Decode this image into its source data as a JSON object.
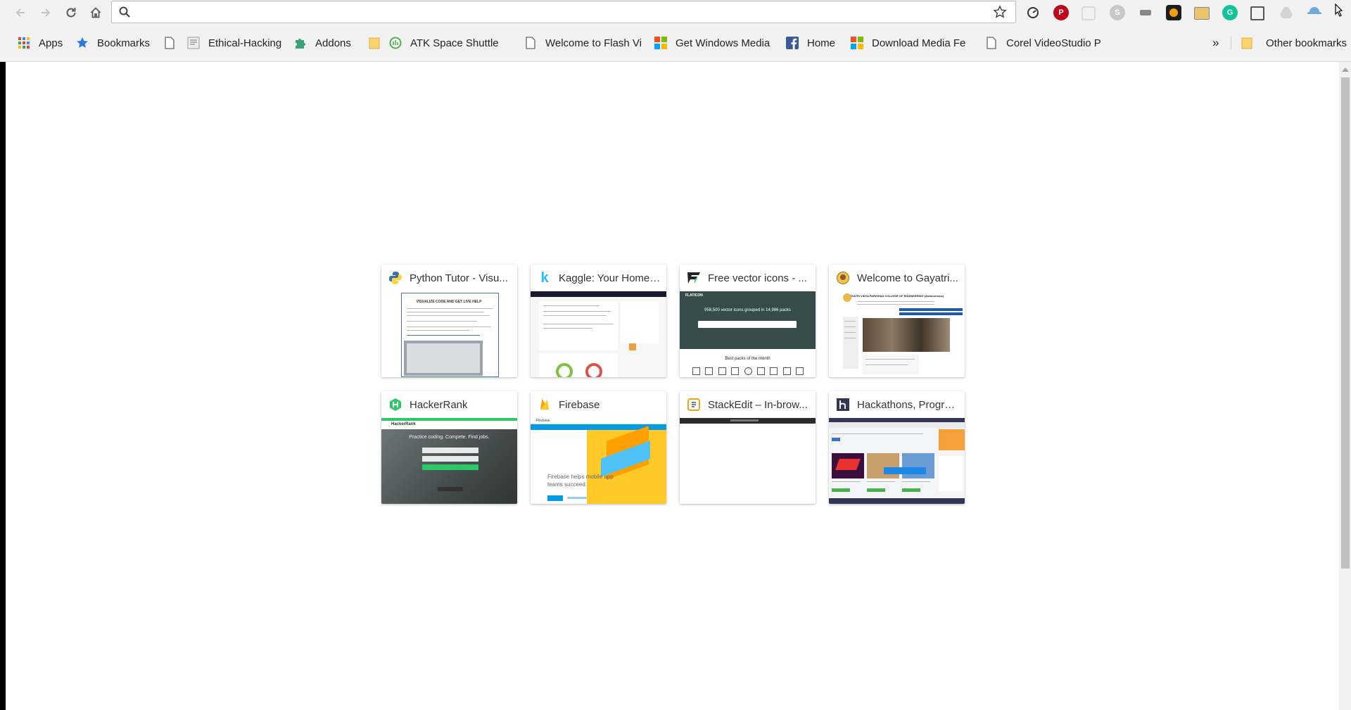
{
  "toolbar": {
    "back_icon": "back-arrow-icon",
    "forward_icon": "forward-arrow-icon",
    "reload_icon": "reload-icon",
    "home_icon": "home-icon",
    "search_icon": "search-icon",
    "address_value": "",
    "star_icon": "bookmark-star-icon",
    "extensions": [
      "speed-dial-icon",
      "pinterest-icon",
      "pocket-icon",
      "skype-icon",
      "extension-icon",
      "tampermonkey-icon",
      "image-icon",
      "grammarly-icon",
      "save-icon",
      "drive-icon",
      "cloud-icon",
      "menu-icon"
    ]
  },
  "bookmarks_bar": {
    "items": [
      {
        "label": "Apps",
        "icon": "apps-grid-icon"
      },
      {
        "label": "Bookmarks",
        "icon": "star-icon"
      },
      {
        "label": "Ethical-Hacking",
        "icon": "page-icon"
      },
      {
        "label": "Addons",
        "icon": "puzzle-icon"
      },
      {
        "label": "ATK Space Shuttle C",
        "icon": "folder-icon"
      },
      {
        "label": "Welcome to Flash Vi",
        "icon": "page-icon"
      },
      {
        "label": "Get Windows Media",
        "icon": "windows-icon"
      },
      {
        "label": "Home",
        "icon": "facebook-icon"
      },
      {
        "label": "Download Media Fe",
        "icon": "windows-icon"
      },
      {
        "label": "Corel VideoStudio P",
        "icon": "page-icon"
      }
    ],
    "overflow_label": "»",
    "other_label": "Other bookmarks"
  },
  "tiles": [
    {
      "title": "Python Tutor - Visu...",
      "icon": "python-icon"
    },
    {
      "title": "Kaggle: Your Home ...",
      "icon": "kaggle-icon"
    },
    {
      "title": "Free vector icons - ...",
      "icon": "flaticon-icon"
    },
    {
      "title": "Welcome to Gayatri...",
      "icon": "college-crest-icon"
    },
    {
      "title": "HackerRank",
      "icon": "hackerrank-icon"
    },
    {
      "title": "Firebase",
      "icon": "firebase-icon"
    },
    {
      "title": "StackEdit – In-brow...",
      "icon": "stackedit-icon"
    },
    {
      "title": "Hackathons, Progra...",
      "icon": "hackerearth-icon"
    }
  ],
  "thumbs": {
    "python": {
      "headline": "VISUALIZE CODE AND GET LIVE HELP"
    },
    "flaticon": {
      "logo": "FLATICON",
      "headline": "958,500 vector icons grouped in 14,986 packs",
      "footer": "Best packs of the month"
    },
    "gayatri": {
      "name": "GAYATRI VIDYA PARISHAD COLLEGE OF ENGINEERING (Autonomous)"
    },
    "hackerrank": {
      "logo": "HackerRank",
      "headline": "Practice coding. Compete. Find jobs."
    },
    "firebase": {
      "logo": "Firebase",
      "headline": "Firebase helps mobile app teams succeed."
    }
  },
  "colors": {
    "chrome_bg": "#f2f2f2",
    "kaggle": "#20beff",
    "hackerrank": "#2ec866",
    "firebase": "#ffca28",
    "pinterest": "#bd081c"
  }
}
